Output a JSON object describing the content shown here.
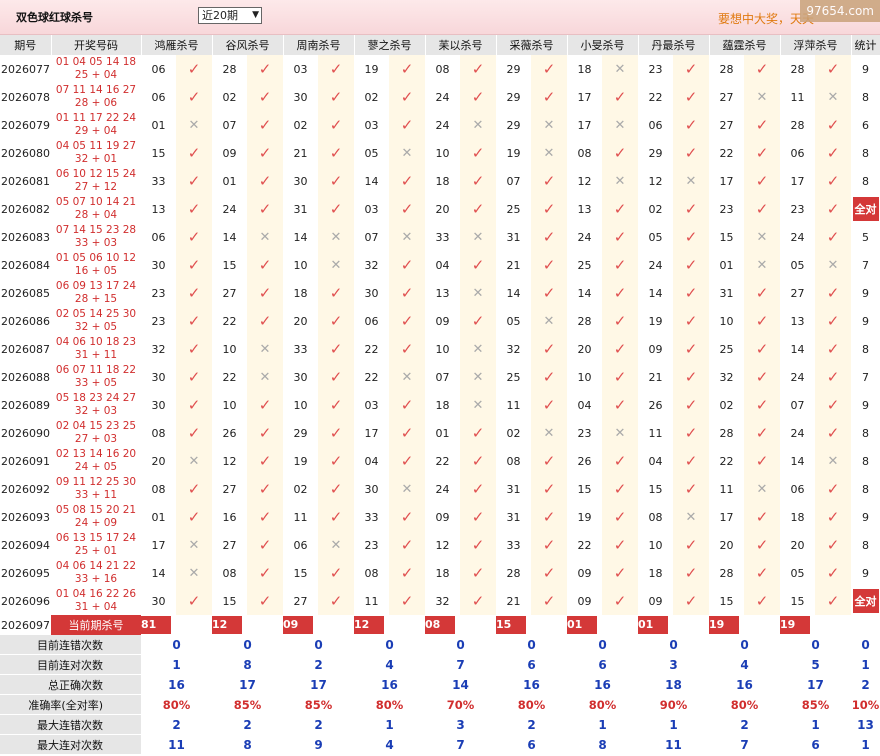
{
  "header": {
    "title": "双色球红球杀号",
    "period_selected": "近20期",
    "slogan": "要想中大奖，天天",
    "watermark": "97654.com"
  },
  "columns": [
    "期号",
    "开奖号码",
    "鸿雁杀号",
    "谷风杀号",
    "周南杀号",
    "蓼之杀号",
    "苿以杀号",
    "采薇杀号",
    "小旻杀号",
    "丹最杀号",
    "蕴霆杀号",
    "浮萍杀号",
    "统计"
  ],
  "rows": [
    {
      "issue": "2026077",
      "draw1": "01 04 05 14 18",
      "draw2": "25 + 04",
      "kills": [
        [
          "06",
          1
        ],
        [
          "28",
          1
        ],
        [
          "03",
          1
        ],
        [
          "19",
          1
        ],
        [
          "08",
          1
        ],
        [
          "29",
          1
        ],
        [
          "18",
          0
        ],
        [
          "23",
          1
        ],
        [
          "28",
          1
        ],
        [
          "28",
          1
        ]
      ],
      "total": "9"
    },
    {
      "issue": "2026078",
      "draw1": "07 11 14 16 27",
      "draw2": "28 + 06",
      "kills": [
        [
          "06",
          1
        ],
        [
          "02",
          1
        ],
        [
          "30",
          1
        ],
        [
          "02",
          1
        ],
        [
          "24",
          1
        ],
        [
          "29",
          1
        ],
        [
          "17",
          1
        ],
        [
          "22",
          1
        ],
        [
          "27",
          0
        ],
        [
          "11",
          0
        ]
      ],
      "total": "8"
    },
    {
      "issue": "2026079",
      "draw1": "01 11 17 22 24",
      "draw2": "29 + 04",
      "kills": [
        [
          "01",
          0
        ],
        [
          "07",
          1
        ],
        [
          "02",
          1
        ],
        [
          "03",
          1
        ],
        [
          "24",
          0
        ],
        [
          "29",
          0
        ],
        [
          "17",
          0
        ],
        [
          "06",
          1
        ],
        [
          "27",
          1
        ],
        [
          "28",
          1
        ]
      ],
      "total": "6"
    },
    {
      "issue": "2026080",
      "draw1": "04 05 11 19 27",
      "draw2": "32 + 01",
      "kills": [
        [
          "15",
          1
        ],
        [
          "09",
          1
        ],
        [
          "21",
          1
        ],
        [
          "05",
          0
        ],
        [
          "10",
          1
        ],
        [
          "19",
          0
        ],
        [
          "08",
          1
        ],
        [
          "29",
          1
        ],
        [
          "22",
          1
        ],
        [
          "06",
          1
        ]
      ],
      "total": "8"
    },
    {
      "issue": "2026081",
      "draw1": "06 10 12 15 24",
      "draw2": "27 + 12",
      "kills": [
        [
          "33",
          1
        ],
        [
          "01",
          1
        ],
        [
          "30",
          1
        ],
        [
          "14",
          1
        ],
        [
          "18",
          1
        ],
        [
          "07",
          1
        ],
        [
          "12",
          0
        ],
        [
          "12",
          0
        ],
        [
          "17",
          1
        ],
        [
          "17",
          1
        ]
      ],
      "total": "8"
    },
    {
      "issue": "2026082",
      "draw1": "05 07 10 14 21",
      "draw2": "28 + 04",
      "kills": [
        [
          "13",
          1
        ],
        [
          "24",
          1
        ],
        [
          "31",
          1
        ],
        [
          "03",
          1
        ],
        [
          "20",
          1
        ],
        [
          "25",
          1
        ],
        [
          "13",
          1
        ],
        [
          "02",
          1
        ],
        [
          "23",
          1
        ],
        [
          "23",
          1
        ]
      ],
      "total": "全对"
    },
    {
      "issue": "2026083",
      "draw1": "07 14 15 23 28",
      "draw2": "33 + 03",
      "kills": [
        [
          "06",
          1
        ],
        [
          "14",
          0
        ],
        [
          "14",
          0
        ],
        [
          "07",
          0
        ],
        [
          "33",
          0
        ],
        [
          "31",
          1
        ],
        [
          "24",
          1
        ],
        [
          "05",
          1
        ],
        [
          "15",
          0
        ],
        [
          "24",
          1
        ]
      ],
      "total": "5"
    },
    {
      "issue": "2026084",
      "draw1": "01 05 06 10 12",
      "draw2": "16 + 05",
      "kills": [
        [
          "30",
          1
        ],
        [
          "15",
          1
        ],
        [
          "10",
          0
        ],
        [
          "32",
          1
        ],
        [
          "04",
          1
        ],
        [
          "21",
          1
        ],
        [
          "25",
          1
        ],
        [
          "24",
          1
        ],
        [
          "01",
          0
        ],
        [
          "05",
          0
        ]
      ],
      "total": "7"
    },
    {
      "issue": "2026085",
      "draw1": "06 09 13 17 24",
      "draw2": "28 + 15",
      "kills": [
        [
          "23",
          1
        ],
        [
          "27",
          1
        ],
        [
          "18",
          1
        ],
        [
          "30",
          1
        ],
        [
          "13",
          0
        ],
        [
          "14",
          1
        ],
        [
          "14",
          1
        ],
        [
          "14",
          1
        ],
        [
          "31",
          1
        ],
        [
          "27",
          1
        ]
      ],
      "total": "9"
    },
    {
      "issue": "2026086",
      "draw1": "02 05 14 25 30",
      "draw2": "32 + 05",
      "kills": [
        [
          "23",
          1
        ],
        [
          "22",
          1
        ],
        [
          "20",
          1
        ],
        [
          "06",
          1
        ],
        [
          "09",
          1
        ],
        [
          "05",
          0
        ],
        [
          "28",
          1
        ],
        [
          "19",
          1
        ],
        [
          "10",
          1
        ],
        [
          "13",
          1
        ]
      ],
      "total": "9"
    },
    {
      "issue": "2026087",
      "draw1": "04 06 10 18 23",
      "draw2": "31 + 11",
      "kills": [
        [
          "32",
          1
        ],
        [
          "10",
          0
        ],
        [
          "33",
          1
        ],
        [
          "22",
          1
        ],
        [
          "10",
          0
        ],
        [
          "32",
          1
        ],
        [
          "20",
          1
        ],
        [
          "09",
          1
        ],
        [
          "25",
          1
        ],
        [
          "14",
          1
        ]
      ],
      "total": "8"
    },
    {
      "issue": "2026088",
      "draw1": "06 07 11 18 22",
      "draw2": "33 + 05",
      "kills": [
        [
          "30",
          1
        ],
        [
          "22",
          0
        ],
        [
          "30",
          1
        ],
        [
          "22",
          0
        ],
        [
          "07",
          0
        ],
        [
          "25",
          1
        ],
        [
          "10",
          1
        ],
        [
          "21",
          1
        ],
        [
          "32",
          1
        ],
        [
          "24",
          1
        ]
      ],
      "total": "7"
    },
    {
      "issue": "2026089",
      "draw1": "05 18 23 24 27",
      "draw2": "32 + 03",
      "kills": [
        [
          "30",
          1
        ],
        [
          "10",
          1
        ],
        [
          "10",
          1
        ],
        [
          "03",
          1
        ],
        [
          "18",
          0
        ],
        [
          "11",
          1
        ],
        [
          "04",
          1
        ],
        [
          "26",
          1
        ],
        [
          "02",
          1
        ],
        [
          "07",
          1
        ]
      ],
      "total": "9"
    },
    {
      "issue": "2026090",
      "draw1": "02 04 15 23 25",
      "draw2": "27 + 03",
      "kills": [
        [
          "08",
          1
        ],
        [
          "26",
          1
        ],
        [
          "29",
          1
        ],
        [
          "17",
          1
        ],
        [
          "01",
          1
        ],
        [
          "02",
          0
        ],
        [
          "23",
          0
        ],
        [
          "11",
          1
        ],
        [
          "28",
          1
        ],
        [
          "24",
          1
        ]
      ],
      "total": "8"
    },
    {
      "issue": "2026091",
      "draw1": "02 13 14 16 20",
      "draw2": "24 + 05",
      "kills": [
        [
          "20",
          0
        ],
        [
          "12",
          1
        ],
        [
          "19",
          1
        ],
        [
          "04",
          1
        ],
        [
          "22",
          1
        ],
        [
          "08",
          1
        ],
        [
          "26",
          1
        ],
        [
          "04",
          1
        ],
        [
          "22",
          1
        ],
        [
          "14",
          0
        ]
      ],
      "total": "8"
    },
    {
      "issue": "2026092",
      "draw1": "09 11 12 25 30",
      "draw2": "33 + 11",
      "kills": [
        [
          "08",
          1
        ],
        [
          "27",
          1
        ],
        [
          "02",
          1
        ],
        [
          "30",
          0
        ],
        [
          "24",
          1
        ],
        [
          "31",
          1
        ],
        [
          "15",
          1
        ],
        [
          "15",
          1
        ],
        [
          "11",
          0
        ],
        [
          "06",
          1
        ]
      ],
      "total": "8"
    },
    {
      "issue": "2026093",
      "draw1": "05 08 15 20 21",
      "draw2": "24 + 09",
      "kills": [
        [
          "01",
          1
        ],
        [
          "16",
          1
        ],
        [
          "11",
          1
        ],
        [
          "33",
          1
        ],
        [
          "09",
          1
        ],
        [
          "31",
          1
        ],
        [
          "19",
          1
        ],
        [
          "08",
          0
        ],
        [
          "17",
          1
        ],
        [
          "18",
          1
        ]
      ],
      "total": "9"
    },
    {
      "issue": "2026094",
      "draw1": "06 13 15 17 24",
      "draw2": "25 + 01",
      "kills": [
        [
          "17",
          0
        ],
        [
          "27",
          1
        ],
        [
          "06",
          0
        ],
        [
          "23",
          1
        ],
        [
          "12",
          1
        ],
        [
          "33",
          1
        ],
        [
          "22",
          1
        ],
        [
          "10",
          1
        ],
        [
          "20",
          1
        ],
        [
          "20",
          1
        ]
      ],
      "total": "8"
    },
    {
      "issue": "2026095",
      "draw1": "04 06 14 21 22",
      "draw2": "33 + 16",
      "kills": [
        [
          "14",
          0
        ],
        [
          "08",
          1
        ],
        [
          "15",
          1
        ],
        [
          "08",
          1
        ],
        [
          "18",
          1
        ],
        [
          "28",
          1
        ],
        [
          "09",
          1
        ],
        [
          "18",
          1
        ],
        [
          "28",
          1
        ],
        [
          "05",
          1
        ]
      ],
      "total": "9"
    },
    {
      "issue": "2026096",
      "draw1": "01 04 16 22 26",
      "draw2": "31 + 04",
      "kills": [
        [
          "30",
          1
        ],
        [
          "15",
          1
        ],
        [
          "27",
          1
        ],
        [
          "11",
          1
        ],
        [
          "32",
          1
        ],
        [
          "21",
          1
        ],
        [
          "09",
          1
        ],
        [
          "09",
          1
        ],
        [
          "15",
          1
        ],
        [
          "15",
          1
        ]
      ],
      "total": "全对"
    }
  ],
  "current": {
    "issue": "2026097",
    "label": "当前期杀号",
    "kills": [
      "81",
      "12",
      "09",
      "12",
      "08",
      "15",
      "01",
      "01",
      "19",
      "19"
    ]
  },
  "stats": [
    {
      "label": "目前连错次数",
      "values": [
        "0",
        "0",
        "0",
        "0",
        "0",
        "0",
        "0",
        "0",
        "0",
        "0",
        "0"
      ],
      "acc": false
    },
    {
      "label": "目前连对次数",
      "values": [
        "1",
        "8",
        "2",
        "4",
        "7",
        "6",
        "6",
        "3",
        "4",
        "5",
        "1"
      ],
      "acc": false
    },
    {
      "label": "总正确次数",
      "values": [
        "16",
        "17",
        "17",
        "16",
        "14",
        "16",
        "16",
        "18",
        "16",
        "17",
        "2"
      ],
      "acc": false
    },
    {
      "label": "准确率(全对率)",
      "values": [
        "80%",
        "85%",
        "85%",
        "80%",
        "70%",
        "80%",
        "80%",
        "90%",
        "80%",
        "85%",
        "10%"
      ],
      "acc": true
    },
    {
      "label": "最大连错次数",
      "values": [
        "2",
        "2",
        "2",
        "1",
        "3",
        "2",
        "1",
        "1",
        "2",
        "1",
        "13"
      ],
      "acc": false
    },
    {
      "label": "最大连对次数",
      "values": [
        "11",
        "8",
        "9",
        "4",
        "7",
        "6",
        "8",
        "11",
        "7",
        "6",
        "1"
      ],
      "acc": false
    }
  ]
}
